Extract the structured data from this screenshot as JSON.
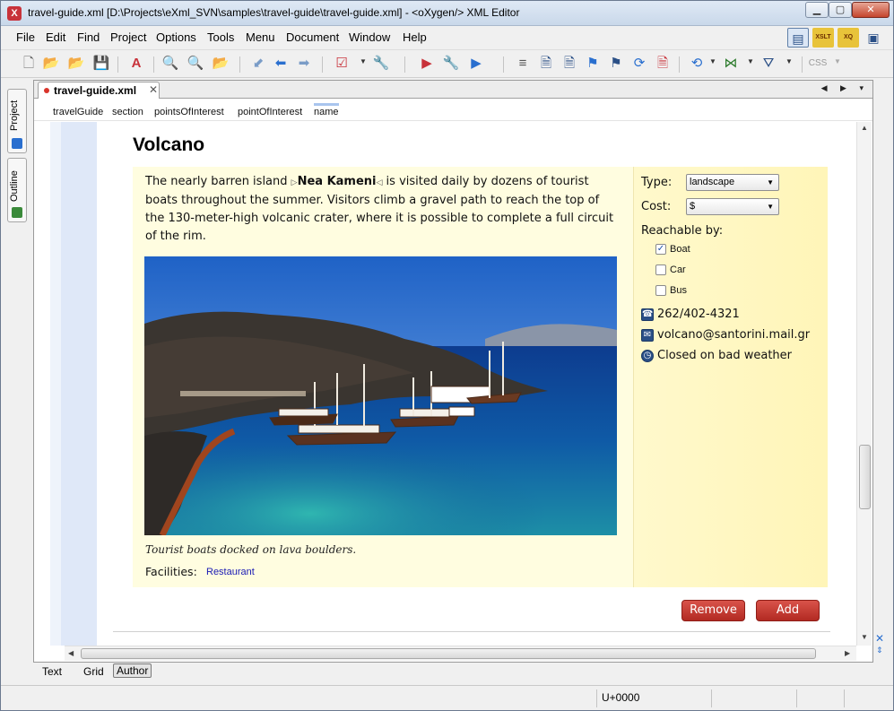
{
  "window": {
    "title": "travel-guide.xml [D:\\Projects\\eXml_SVN\\samples\\travel-guide\\travel-guide.xml] - <oXygen/> XML Editor",
    "minimize": "▁",
    "maximize": "▢",
    "close": "✕"
  },
  "menu": [
    "File",
    "Edit",
    "Find",
    "Project",
    "Options",
    "Tools",
    "Menu",
    "Document",
    "Window",
    "Help"
  ],
  "view_tools": [
    "XSLT",
    "XQ"
  ],
  "toolbar_css_label": "CSS",
  "side_tabs": {
    "project": "Project",
    "outline": "Outline"
  },
  "editor_tab": {
    "label": "travel-guide.xml",
    "close": "✕",
    "nav": "◀ ▶ ▾"
  },
  "breadcrumb": [
    "travelGuide",
    "section",
    "pointsOfInterest",
    "pointOfInterest",
    "name"
  ],
  "poi": {
    "name": "Volcano",
    "desc_before": "The nearly barren island ",
    "desc_island": "Nea Kameni",
    "desc_after": " is visited daily by dozens of tourist boats throughout the summer. Visitors climb a gravel path to reach the top of the 130-meter-high volcanic crater, where it is possible to complete a full circuit of the rim.",
    "caption": "Tourist boats docked on lava boulders.",
    "facilities_label": "Facilities:",
    "facility": "Restaurant",
    "type_label": "Type:",
    "type_value": "landscape",
    "cost_label": "Cost:",
    "cost_value": "$",
    "reachable_label": "Reachable by:",
    "reachable": [
      {
        "label": "Boat",
        "checked": true,
        "mark": "✓"
      },
      {
        "label": "Car",
        "checked": false,
        "mark": ""
      },
      {
        "label": "Bus",
        "checked": false,
        "mark": ""
      }
    ],
    "phone": "262/402-4321",
    "email": "volcano@santorini.mail.gr",
    "hours": "Closed on bad weather",
    "remove_button": "Remove",
    "add_button": "Add"
  },
  "modes": [
    "Text",
    "Grid",
    "Author"
  ],
  "active_mode": "Author",
  "status": {
    "unicode": "U+0000"
  }
}
